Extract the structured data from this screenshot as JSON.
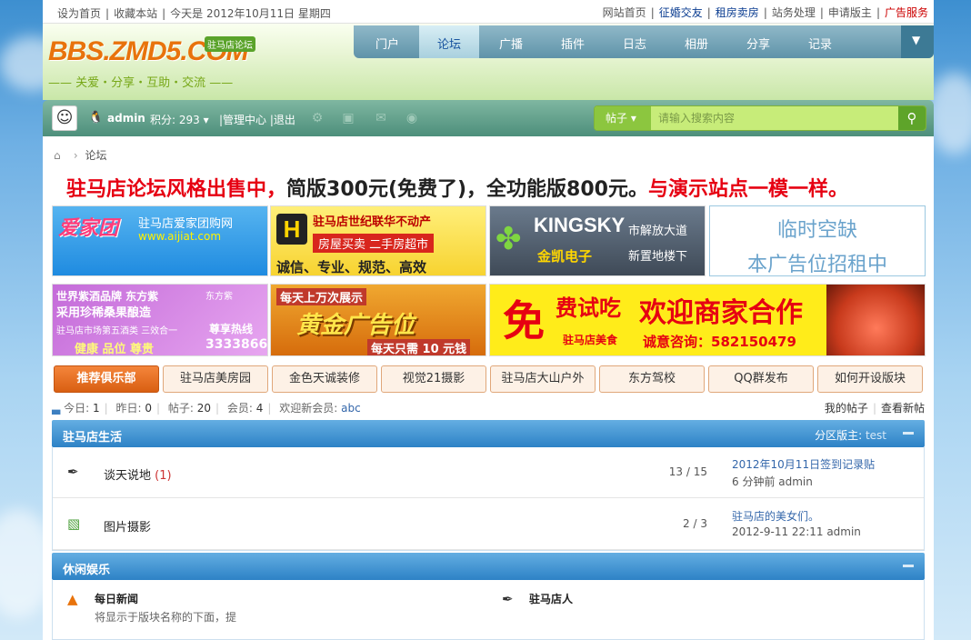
{
  "topbar": {
    "left_links": [
      "设为首页",
      "收藏本站"
    ],
    "date_text": "今天是  2012年10月11日 星期四",
    "right_links": [
      "网站首页",
      "征婚交友",
      "租房卖房",
      "站务处理",
      "申请版主",
      "广告服务"
    ]
  },
  "logo": {
    "text": "BBS.ZMD5.COM",
    "badge": "驻马店论坛",
    "slogan": "—— 关爱・分享・互助・交流 ——"
  },
  "nav": {
    "items": [
      "门户",
      "论坛",
      "广播",
      "插件",
      "日志",
      "相册",
      "分享",
      "记录"
    ],
    "active": "论坛",
    "dropdown_icon": "chevron-down-icon"
  },
  "user": {
    "avatar_icon": "avatar-icon",
    "qq_icon": "qq-icon",
    "name": "admin",
    "credit": "积分: 293",
    "admin_links": "|管理中心 |退出"
  },
  "search": {
    "scope": "帖子",
    "placeholder": "请输入搜索内容",
    "button_icon": "search-icon"
  },
  "breadcrumb": {
    "home_icon": "home-icon",
    "current": "论坛"
  },
  "sale_banner": {
    "part1": "驻马店论坛风格出售中，",
    "part2": "简版300元(免费了)，全功能版800元。",
    "part3": "与演示站点一模一样。"
  },
  "ads": {
    "a1": {
      "brand": "爱家团",
      "title": "驻马店爱家团购网",
      "url": "www.aijiat.com"
    },
    "a2": {
      "letter": "H",
      "title": "驻马店世纪联华不动产",
      "line2": "房屋买卖  二手房超市",
      "line3": "诚信、专业、规范、高效"
    },
    "a3": {
      "brand": "KINGSKY",
      "cn": "金凯电子",
      "addr1": "市解放大道",
      "addr2": "新置地楼下"
    },
    "a4": {
      "line1": "临时空缺",
      "line2": "本广告位招租中"
    },
    "a5": {
      "line1": "世界紫酒品牌 东方紫",
      "line2": "采用珍稀桑果酿造",
      "line3": "驻马店市场第五酒类 三效合一",
      "line4": "健康 品位 尊贵",
      "logo": "东方紫",
      "hotline_label": "尊享热线",
      "phone": "3333866"
    },
    "a6": {
      "top": "每天上万次展示",
      "big": "黄金广告位",
      "bottom": "每天只需 10 元钱"
    },
    "a7": {
      "free": "免",
      "try": "费试吃",
      "brand": "驻马店美食",
      "main": "欢迎商家合作",
      "tel": "诚意咨询：582150479"
    }
  },
  "club_tabs": [
    "推荐俱乐部",
    "驻马店美房园",
    "金色天诚装修",
    "视觉21摄影",
    "驻马店大山户外",
    "东方驾校",
    "QQ群发布",
    "如何开设版块"
  ],
  "stats": {
    "today_label": "今日:",
    "today": "1",
    "yesterday_label": "昨日:",
    "yesterday": "0",
    "posts_label": "帖子:",
    "posts": "20",
    "members_label": "会员:",
    "members": "4",
    "welcome_label": "欢迎新会员:",
    "newest": "abc",
    "my_posts": "我的帖子",
    "new_posts": "查看新帖"
  },
  "sections": [
    {
      "title": "驻马店生活",
      "moderator_label": "分区版主:",
      "moderator": "test",
      "forums": [
        {
          "icon": "forum-icon",
          "name": "谈天说地",
          "today": "(1)",
          "counts": "13 / 15",
          "last_title": "2012年10月11日签到记录贴",
          "last_meta": "6 分钟前 admin"
        },
        {
          "icon": "photo-icon",
          "name": "图片摄影",
          "today": "",
          "counts": "2 / 3",
          "last_title": "驻马店的美女们。",
          "last_meta": "2012-9-11 22:11 admin"
        }
      ]
    },
    {
      "title": "休闲娱乐",
      "items": [
        {
          "icon": "news-icon",
          "name": "每日新闻",
          "desc": "将显示于版块名称的下面，提"
        },
        {
          "icon": "forum-icon",
          "name": "驻马店人",
          "desc": ""
        }
      ]
    }
  ],
  "colors": {
    "accent": "#2d82c6",
    "sale_red": "#e60012",
    "tab_orange": "#d95f12",
    "userbar": "#4d8f7b"
  }
}
